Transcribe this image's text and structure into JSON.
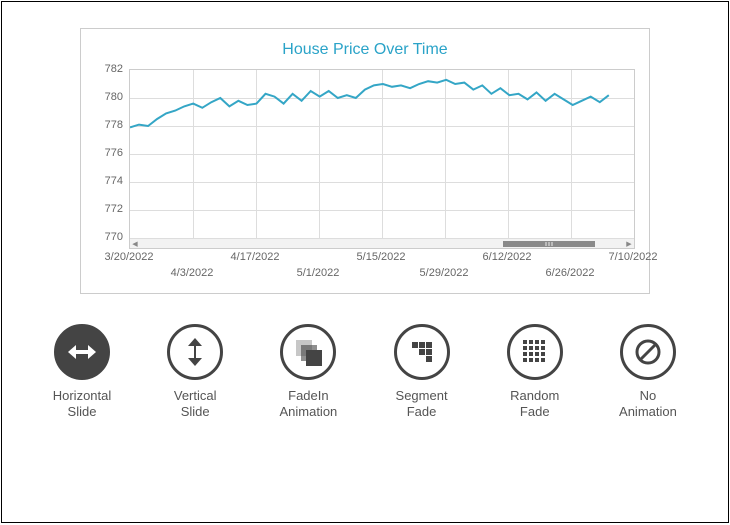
{
  "chart_data": {
    "type": "line",
    "title": "House Price Over Time",
    "xlabel": "",
    "ylabel": "",
    "ylim": [
      770,
      782
    ],
    "x_ticks_major": [
      "3/20/2022",
      "4/17/2022",
      "5/15/2022",
      "6/12/2022",
      "7/10/2022"
    ],
    "x_ticks_minor": [
      "4/3/2022",
      "5/1/2022",
      "5/29/2022",
      "6/26/2022"
    ],
    "y_ticks": [
      770,
      772,
      774,
      776,
      778,
      780,
      782
    ],
    "line_color": "#34a6c6",
    "series": [
      {
        "name": "House Price",
        "x": [
          "3/20/2022",
          "3/22/2022",
          "3/24/2022",
          "3/26/2022",
          "3/28/2022",
          "3/30/2022",
          "4/1/2022",
          "4/3/2022",
          "4/5/2022",
          "4/7/2022",
          "4/9/2022",
          "4/11/2022",
          "4/13/2022",
          "4/15/2022",
          "4/17/2022",
          "4/19/2022",
          "4/21/2022",
          "4/23/2022",
          "4/25/2022",
          "4/27/2022",
          "4/29/2022",
          "5/1/2022",
          "5/3/2022",
          "5/5/2022",
          "5/7/2022",
          "5/9/2022",
          "5/11/2022",
          "5/13/2022",
          "5/15/2022",
          "5/17/2022",
          "5/19/2022",
          "5/21/2022",
          "5/23/2022",
          "5/25/2022",
          "5/27/2022",
          "5/29/2022",
          "5/31/2022",
          "6/2/2022",
          "6/4/2022",
          "6/6/2022",
          "6/8/2022",
          "6/10/2022",
          "6/12/2022",
          "6/14/2022",
          "6/16/2022",
          "6/18/2022",
          "6/20/2022",
          "6/22/2022",
          "6/24/2022",
          "6/26/2022",
          "6/28/2022",
          "6/30/2022",
          "7/2/2022",
          "7/4/2022"
        ],
        "values": [
          777.9,
          778.1,
          778.0,
          778.5,
          778.9,
          779.1,
          779.4,
          779.6,
          779.3,
          779.7,
          780.0,
          779.4,
          779.8,
          779.5,
          779.6,
          780.3,
          780.1,
          779.6,
          780.3,
          779.8,
          780.5,
          780.1,
          780.5,
          780.0,
          780.2,
          780.0,
          780.6,
          780.9,
          781.0,
          780.8,
          780.9,
          780.7,
          781.0,
          781.2,
          781.1,
          781.3,
          781.0,
          781.1,
          780.6,
          780.9,
          780.3,
          780.7,
          780.2,
          780.3,
          779.9,
          780.4,
          779.8,
          780.3,
          779.9,
          779.5,
          779.8,
          780.1,
          779.7,
          780.2
        ]
      }
    ],
    "scrollbar": {
      "thumb_start_pct": 75,
      "thumb_end_pct": 94
    }
  },
  "animation_options": [
    {
      "id": "horizontal-slide",
      "label_line1": "Horizontal",
      "label_line2": "Slide",
      "icon": "hslide",
      "selected": true
    },
    {
      "id": "vertical-slide",
      "label_line1": "Vertical",
      "label_line2": "Slide",
      "icon": "vslide",
      "selected": false
    },
    {
      "id": "fadein",
      "label_line1": "FadeIn",
      "label_line2": "Animation",
      "icon": "fade",
      "selected": false
    },
    {
      "id": "segment-fade",
      "label_line1": "Segment",
      "label_line2": "Fade",
      "icon": "segment",
      "selected": false
    },
    {
      "id": "random-fade",
      "label_line1": "Random",
      "label_line2": "Fade",
      "icon": "random",
      "selected": false
    },
    {
      "id": "no-animation",
      "label_line1": "No",
      "label_line2": "Animation",
      "icon": "none",
      "selected": false
    }
  ]
}
